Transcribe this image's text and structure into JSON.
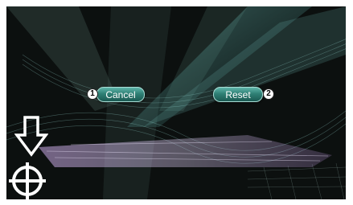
{
  "buttons": {
    "cancel_label": "Cancel",
    "reset_label": "Reset"
  },
  "callouts": {
    "cancel_number": "1",
    "reset_number": "2"
  },
  "icons": {
    "arrow": "down-arrow-icon",
    "target": "crosshair-icon"
  },
  "colors": {
    "button_top": "#5fb5aa",
    "button_bottom": "#1b5a52",
    "background": "#0a0d0c"
  }
}
